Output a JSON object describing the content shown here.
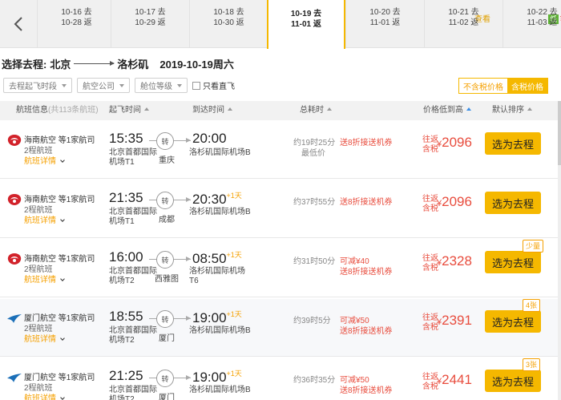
{
  "dates": [
    {
      "go": "10-16 去",
      "back": "10-28 返",
      "price": "查看",
      "low": false,
      "active": false
    },
    {
      "go": "10-17 去",
      "back": "10-29 返",
      "price": "¥2096",
      "low": true,
      "active": false
    },
    {
      "go": "10-18 去",
      "back": "10-30 返",
      "price": "查看",
      "low": false,
      "active": false
    },
    {
      "go": "10-19 去",
      "back": "11-01 返",
      "price": "¥2096",
      "low": true,
      "active": true
    },
    {
      "go": "10-20 去",
      "back": "11-01 返",
      "price": "查看",
      "low": false,
      "active": false
    },
    {
      "go": "10-21 去",
      "back": "11-02 返",
      "price": "查看",
      "low": false,
      "active": false
    },
    {
      "go": "10-22 去",
      "back": "11-03 返",
      "price": "查看",
      "low": false,
      "active": false
    }
  ],
  "low_tag": "低",
  "route": {
    "prefix": "选择去程:",
    "from": "北京",
    "to": "洛杉矶",
    "date": "2019-10-19周六"
  },
  "filters": {
    "time": "去程起飞时段",
    "airline": "航空公司",
    "cabin": "舱位等级",
    "direct": "只看直飞",
    "tax_off": "不含税价格",
    "tax_on": "含税价格"
  },
  "header": {
    "flight_info": "航班信息",
    "flight_count": "(共113条航班)",
    "dep": "起飞时间",
    "arr": "到达时间",
    "duration": "总耗时",
    "price": "价格低到高",
    "sort": "默认排序"
  },
  "common": {
    "detail": "航班详情",
    "select": "选为去程",
    "via_icon": "转",
    "price_top": "往返",
    "price_bottom": "含税"
  },
  "flights": [
    {
      "airline": "海南航空 等1家航司",
      "logo": "hainan",
      "stops": "2程航班",
      "dep_time": "15:35",
      "dep_airport": "北京首都国际机场T1",
      "via": "重庆",
      "arr_time": "20:00",
      "plus_day": "",
      "arr_airport": "洛杉矶国际机场B",
      "duration": "约19时25分",
      "cheapest": "最低价",
      "promo1": "送8折接送机券",
      "promo2": "",
      "price": "2096",
      "badge": ""
    },
    {
      "airline": "海南航空 等1家航司",
      "logo": "hainan",
      "stops": "2程航班",
      "dep_time": "21:35",
      "dep_airport": "北京首都国际机场T1",
      "via": "成都",
      "arr_time": "20:30",
      "plus_day": "+1天",
      "arr_airport": "洛杉矶国际机场B",
      "duration": "约37时55分",
      "cheapest": "",
      "promo1": "送8折接送机券",
      "promo2": "",
      "price": "2096",
      "badge": ""
    },
    {
      "airline": "海南航空 等1家航司",
      "logo": "hainan",
      "stops": "2程航班",
      "dep_time": "16:00",
      "dep_airport": "北京首都国际机场T2",
      "via": "西雅图",
      "arr_time": "08:50",
      "plus_day": "+1天",
      "arr_airport": "洛杉矶国际机场T6",
      "duration": "约31时50分",
      "cheapest": "",
      "promo1": "可减¥40",
      "promo2": "送8折接送机券",
      "price": "2328",
      "badge": "少量"
    },
    {
      "airline": "厦门航空 等1家航司",
      "logo": "xiamen",
      "stops": "2程航班",
      "dep_time": "18:55",
      "dep_airport": "北京首都国际机场T2",
      "via": "厦门",
      "arr_time": "19:00",
      "plus_day": "+1天",
      "arr_airport": "洛杉矶国际机场B",
      "duration": "约39时5分",
      "cheapest": "",
      "promo1": "可减¥50",
      "promo2": "送8折接送机券",
      "price": "2391",
      "badge": "4张"
    },
    {
      "airline": "厦门航空 等1家航司",
      "logo": "xiamen",
      "stops": "2程航班",
      "dep_time": "21:25",
      "dep_airport": "北京首都国际机场T2",
      "via": "厦门",
      "arr_time": "19:00",
      "plus_day": "+1天",
      "arr_airport": "洛杉矶国际机场B",
      "duration": "约36时35分",
      "cheapest": "",
      "promo1": "可减¥50",
      "promo2": "送8折接送机券",
      "price": "2441",
      "badge": "3张"
    }
  ],
  "colors": {
    "accent": "#f5b800",
    "price": "#e84c3d",
    "orange": "#f5a000",
    "low_green": "#5fb336"
  }
}
